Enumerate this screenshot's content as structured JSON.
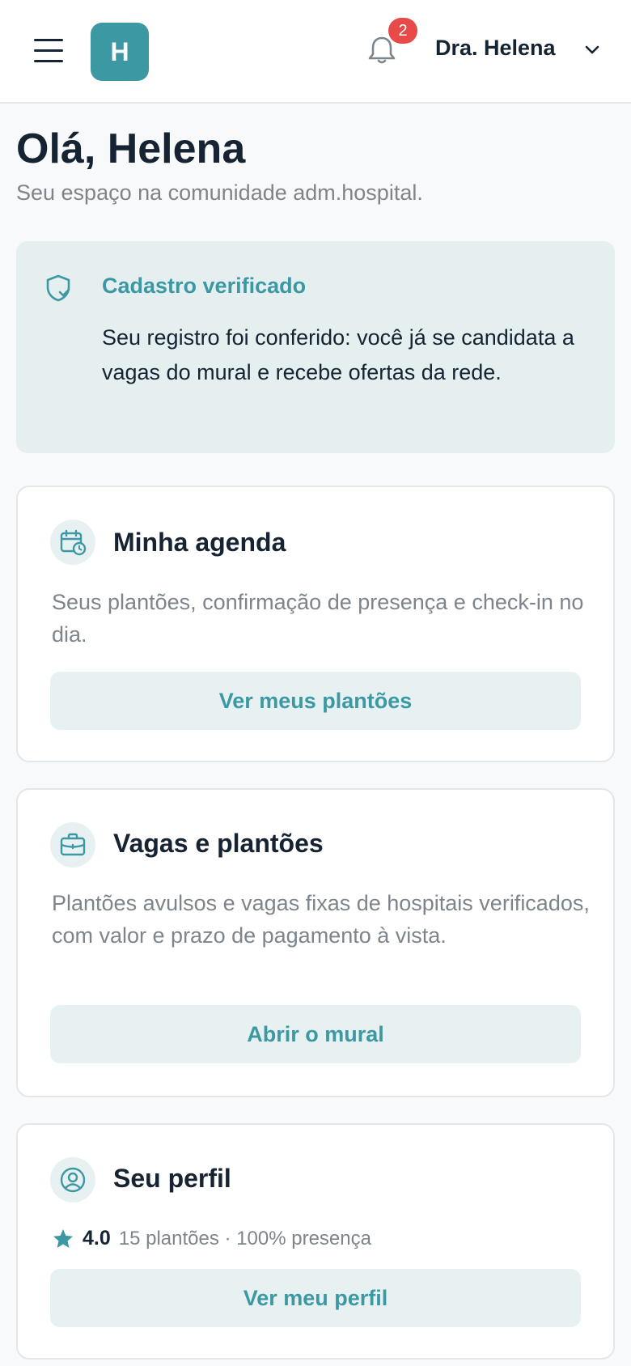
{
  "header": {
    "logo_letter": "H",
    "notification_count": "2",
    "user_name": "Dra. Helena"
  },
  "greeting": {
    "title": "Olá, Helena",
    "subtitle": "Seu espaço na comunidade adm.hospital."
  },
  "verification": {
    "title": "Cadastro verificado",
    "text": "Seu registro foi conferido: você já se candidata a vagas do mural e recebe ofertas da rede."
  },
  "cards": {
    "agenda": {
      "title": "Minha agenda",
      "description": "Seus plantões, confirmação de presença e check-in no dia.",
      "button": "Ver meus plantões",
      "icon": "calendar-clock-icon"
    },
    "vagas": {
      "title": "Vagas e plantões",
      "description": "Plantões avulsos e vagas fixas de hospitais verificados, com valor e prazo de pagamento à vista.",
      "button": "Abrir o mural",
      "icon": "briefcase-icon"
    },
    "perfil": {
      "title": "Seu perfil",
      "rating": "4.0",
      "stats": "15 plantões · 100% presença",
      "button": "Ver meu perfil",
      "icon": "user-circle-icon"
    }
  },
  "colors": {
    "accent": "#3c98a3",
    "accent_light": "#e8f1f2",
    "badge": "#e84a4a",
    "text": "#152332",
    "muted": "#7d858c"
  }
}
